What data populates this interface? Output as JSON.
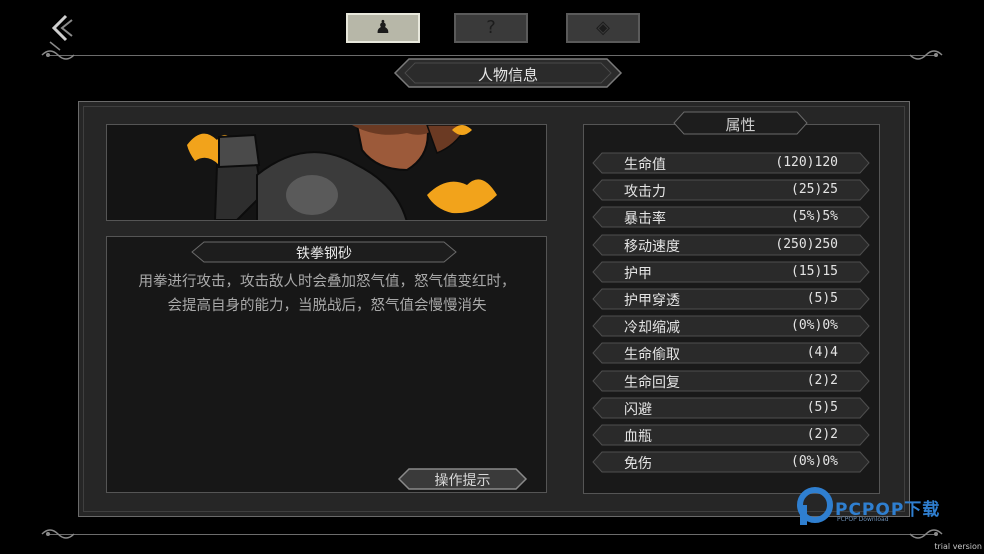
{
  "tabs": [
    {
      "icon": "character-icon",
      "glyph": "♟",
      "active": true
    },
    {
      "icon": "question-icon",
      "glyph": "?",
      "active": false
    },
    {
      "icon": "diamond-target-icon",
      "glyph": "◈",
      "active": false
    }
  ],
  "title": "人物信息",
  "skill": {
    "name": "铁拳钢砂",
    "description_lines": [
      "用拳进行攻击，攻击敌人时会叠加怒气值，怒气值变红时，",
      "会提高自身的能力，当脱战后，怒气值会慢慢消失"
    ]
  },
  "operation_button": "操作提示",
  "attributes": {
    "header": "属性",
    "rows": [
      {
        "name": "生命值",
        "value": "(120)120"
      },
      {
        "name": "攻击力",
        "value": "(25)25"
      },
      {
        "name": "暴击率",
        "value": "(5%)5%"
      },
      {
        "name": "移动速度",
        "value": "(250)250"
      },
      {
        "name": "护甲",
        "value": "(15)15"
      },
      {
        "name": "护甲穿透",
        "value": "(5)5"
      },
      {
        "name": "冷却缩减",
        "value": "(0%)0%"
      },
      {
        "name": "生命偷取",
        "value": "(4)4"
      },
      {
        "name": "生命回复",
        "value": "(2)2"
      },
      {
        "name": "闪避",
        "value": "(5)5"
      },
      {
        "name": "血瓶",
        "value": "(2)2"
      },
      {
        "name": "免伤",
        "value": "(0%)0%"
      }
    ]
  },
  "watermark": {
    "brand": "PCPOP下载",
    "sub": "PCPOP Download"
  },
  "trial_text": "trial version",
  "colors": {
    "fire": "#f2a31b",
    "skin": "#9c5a3a",
    "hair": "#6b3a23",
    "armor": "#3b3b3b"
  }
}
